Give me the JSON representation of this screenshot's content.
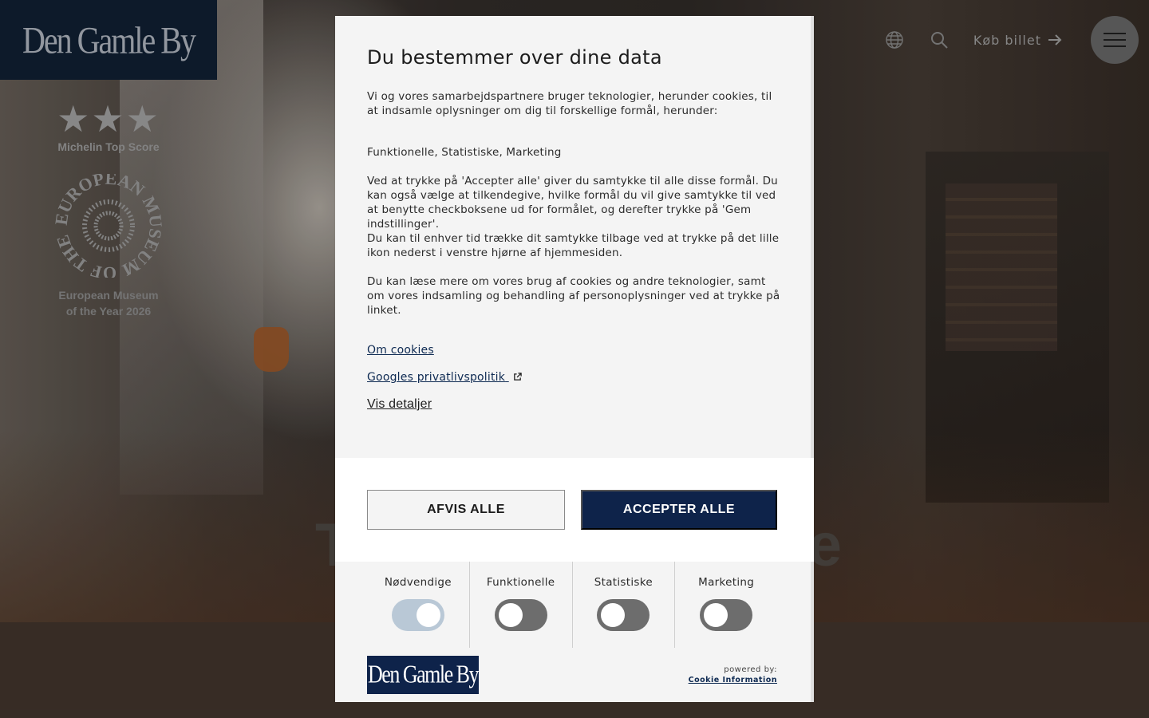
{
  "site": {
    "logo_text": "Den Gamle By",
    "hero_title_left": "T",
    "hero_title_right": "e",
    "awards": {
      "stars": "★★★",
      "michelin_label": "Michelin Top Score",
      "seal_text": "EUROPEAN MUSEUM OF THE YEAR AWARD",
      "museum_label_line1": "European Museum",
      "museum_label_line2": "of the Year 2026"
    },
    "nav": {
      "language_icon": "globe-icon",
      "search_icon": "search-icon",
      "buy_ticket_label": "Køb billet",
      "menu_icon": "hamburger-icon"
    }
  },
  "consent": {
    "title": "Du bestemmer over dine data",
    "intro": "Vi og vores samarbejdspartnere bruger teknologier, herunder cookies, til at indsamle oplysninger om dig til forskellige formål, herunder:",
    "purposes": "Funktionelle, Statistiske, Marketing",
    "accept_info": "Ved at trykke på 'Accepter alle' giver du samtykke til alle disse formål. Du kan også vælge at tilkendegive, hvilke formål du vil give samtykke til ved at benytte checkboksene ud for formålet, og derefter trykke på 'Gem indstillinger'.",
    "withdraw_info": "Du kan til enhver tid trække dit samtykke tilbage ved at trykke på det lille ikon nederst i venstre hjørne af hjemmesiden.",
    "read_more": "Du kan læse mere om vores brug af cookies og andre teknologier, samt om vores indsamling og behandling af personoplysninger ved at trykke på linket.",
    "links": {
      "about_cookies": "Om cookies",
      "google_privacy": "Googles privatlivspolitik",
      "show_details": "Vis detaljer"
    },
    "buttons": {
      "reject_all": "AFVIS ALLE",
      "accept_all": "ACCEPTER ALLE"
    },
    "toggles": [
      {
        "label": "Nødvendige",
        "on": true
      },
      {
        "label": "Funktionelle",
        "on": false
      },
      {
        "label": "Statistiske",
        "on": false
      },
      {
        "label": "Marketing",
        "on": false
      }
    ],
    "footer": {
      "logo_text": "Den Gamle By",
      "powered_by": "powered by:",
      "provider": "Cookie Information"
    }
  },
  "colors": {
    "navy": "#0e234a",
    "logo_bg": "#0e1c2d",
    "dialog_bg": "#f4f4f4"
  }
}
